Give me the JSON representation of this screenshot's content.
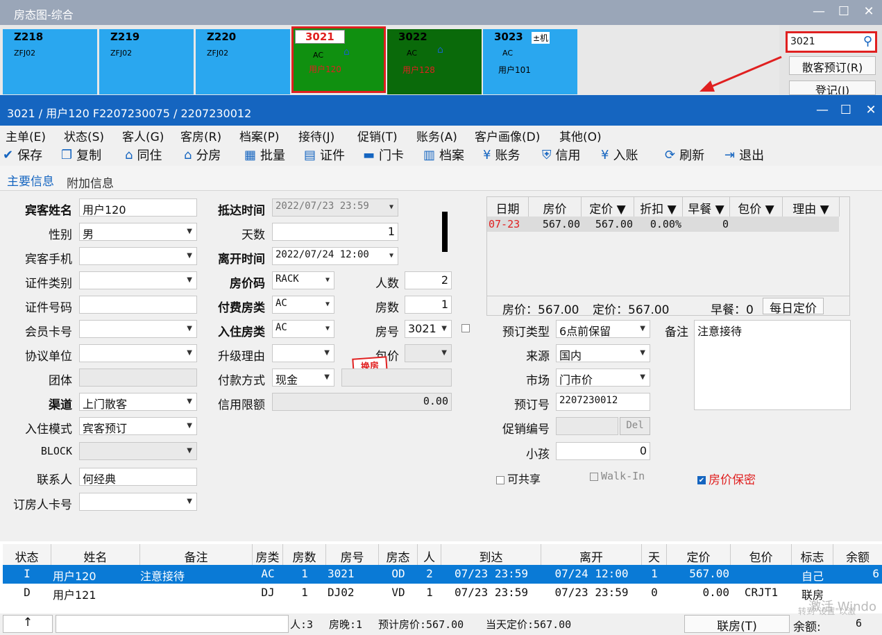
{
  "bg_window": {
    "title": "房态图-综合",
    "min": "—",
    "max": "☐",
    "close": "✕",
    "rooms": [
      {
        "no": "Z218",
        "code": "ZFJ02",
        "user": "",
        "color": "#2aa7ef",
        "tag": ""
      },
      {
        "no": "Z219",
        "code": "ZFJ02",
        "user": "",
        "color": "#2aa7ef",
        "tag": ""
      },
      {
        "no": "Z220",
        "code": "ZFJ02",
        "user": "",
        "color": "#2aa7ef",
        "tag": ""
      },
      {
        "no": "3021",
        "code": "AC",
        "user": "用户120",
        "color": "#109010",
        "tag": ""
      },
      {
        "no": "3022",
        "code": "AC",
        "user": "用户128",
        "color": "#0a6a0a",
        "tag": ""
      },
      {
        "no": "3023",
        "code": "AC",
        "user": "用户101",
        "color": "#2aa7ef",
        "tag": "±机"
      }
    ],
    "search_value": "3021",
    "btn_reserve": "散客预订(R)",
    "btn_register": "登记(I)"
  },
  "window": {
    "title": "3021 / 用户120 F2207230075 / 2207230012",
    "min": "—",
    "max": "☐",
    "close": "✕"
  },
  "menu": [
    "主单(E)",
    "状态(S)",
    "客人(G)",
    "客房(R)",
    "档案(P)",
    "接待(J)",
    "促销(T)",
    "账务(A)",
    "客户画像(D)",
    "其他(O)"
  ],
  "toolbar": [
    "保存",
    "复制",
    "同住",
    "分房",
    "批量",
    "证件",
    "门卡",
    "档案",
    "账务",
    "信用",
    "入账",
    "刷新",
    "退出"
  ],
  "tabs": {
    "main": "主要信息",
    "extra": "附加信息"
  },
  "form": {
    "guest_name_label": "宾客姓名",
    "guest_name": "用户120",
    "gender_label": "性别",
    "gender": "男",
    "mobile_label": "宾客手机",
    "mobile": "",
    "id_type_label": "证件类别",
    "id_type": "",
    "id_no_label": "证件号码",
    "id_no": "",
    "member_label": "会员卡号",
    "member": "",
    "company_label": "协议单位",
    "company": "",
    "group_label": "团体",
    "group": "",
    "channel_label": "渠道",
    "channel": "上门散客",
    "checkin_mode_label": "入住模式",
    "checkin_mode": "宾客预订",
    "block_label": "BLOCK",
    "block": "",
    "contact_label": "联系人",
    "contact": "何经典",
    "booker_label": "订房人卡号",
    "booker": "",
    "arrive_label": "抵达时间",
    "arrive": "2022/07/23 23:59",
    "days_label": "天数",
    "days": "1",
    "depart_label": "离开时间",
    "depart": "2022/07/24 12:00",
    "rate_code_label": "房价码",
    "rate_code": "RACK",
    "persons_label": "人数",
    "persons": "2",
    "pay_room_type_label": "付费房类",
    "pay_room_type": "AC",
    "rooms_label": "房数",
    "rooms": "1",
    "room_type_label": "入住房类",
    "room_type": "AC",
    "room_no_label": "房号",
    "room_no": "3021",
    "upgrade_label": "升级理由",
    "upgrade": "",
    "package_label": "包价",
    "package": "",
    "stamp": "换房",
    "pay_method_label": "付款方式",
    "pay_method": "现金",
    "credit_label": "信用限额",
    "credit": "0.00",
    "resv_type_label": "预订类型",
    "resv_type": "6点前保留",
    "source_label": "来源",
    "source": "国内",
    "market_label": "市场",
    "market": "门市价",
    "resv_no_label": "预订号",
    "resv_no": "2207230012",
    "promo_label": "促销编号",
    "promo": "",
    "del_btn": "Del",
    "child_label": "小孩",
    "child": "0",
    "remark_label": "备注",
    "remark": "注意接待",
    "share_label": "可共享",
    "walkin_label": "Walk-In",
    "secret_label": "房价保密"
  },
  "price_grid": {
    "headers": [
      "日期",
      "房价",
      "定价 ▼",
      "折扣 ▼",
      "早餐 ▼",
      "包价 ▼",
      "理由 ▼"
    ],
    "row": [
      "07-23",
      "567.00",
      "567.00",
      "0.00%",
      "0",
      "",
      ""
    ],
    "summary_price": "房价：567.00",
    "summary_rate": "定价：567.00",
    "summary_bf": "早餐：0",
    "daily_btn": "每日定价"
  },
  "table": {
    "headers": [
      "状态",
      "姓名",
      "备注",
      "房类",
      "房数",
      "房号",
      "房态",
      "人",
      "到达",
      "离开",
      "天",
      "定价",
      "包价",
      "标志",
      "余额"
    ],
    "rows": [
      [
        "I",
        "用户120",
        "注意接待",
        "AC",
        "1",
        "3021",
        "OD",
        "2",
        "07/23 23:59",
        "07/24 12:00",
        "1",
        "567.00",
        "",
        "自己",
        "6"
      ],
      [
        "D",
        "用户121",
        "",
        "DJ",
        "1",
        "DJ02",
        "VD",
        "1",
        "07/23 23:59",
        "07/23 23:59",
        "0",
        "0.00",
        "CRJT1",
        "联房",
        ""
      ]
    ]
  },
  "status": {
    "arrow": "↑",
    "persons": "人:3",
    "nights": "房晚:1",
    "expected": "预计房价:567.00",
    "today": "当天定价:567.00",
    "link_btn": "联房(T)",
    "balance": "余额:",
    "balance_val": "6",
    "watermark1": "激活 Windo",
    "watermark2": "转到\"设置\"以激"
  },
  "colors": {
    "accent": "#1565c0",
    "highlight": "#e02020",
    "selected_row": "#0a7ad6"
  }
}
